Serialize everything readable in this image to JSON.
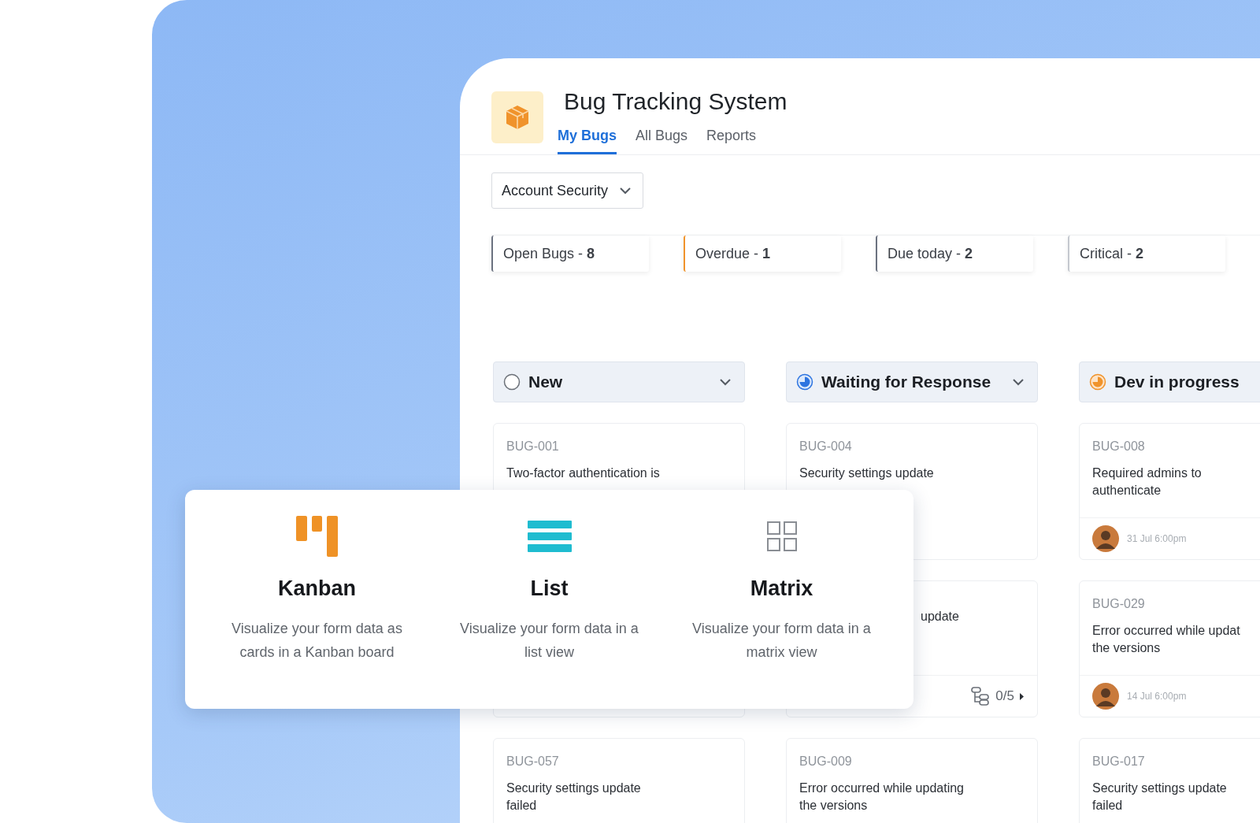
{
  "app": {
    "title": "Bug Tracking System",
    "tabs": [
      {
        "label": "My Bugs",
        "selected": true
      },
      {
        "label": "All Bugs",
        "selected": false
      },
      {
        "label": "Reports",
        "selected": false
      }
    ],
    "filter": {
      "value": "Account Security"
    },
    "stats": [
      {
        "text": "Open Bugs - **8**",
        "color": "#6b7280"
      },
      {
        "text": "Overdue - **1**",
        "color": "#f0932b"
      },
      {
        "text": "Due today - **2**",
        "color": "#6b7280"
      },
      {
        "text": "Critical - **2**",
        "color": "#c4c8cf"
      }
    ],
    "columns": [
      {
        "title": "New",
        "kind": "new",
        "chevron": true,
        "cards": [
          {
            "kind": "card",
            "id": "BUG-001",
            "title": "Two-factor authentication is"
          },
          {
            "kind": "hidden"
          },
          {
            "kind": "card",
            "id": "BUG-057",
            "title": "Security settings update\nfailed"
          }
        ]
      },
      {
        "title": "Waiting for Response",
        "kind": "waiting",
        "chevron": true,
        "cards": [
          {
            "kind": "card",
            "id": "BUG-004",
            "title": "Security settings update"
          },
          {
            "kind": "covered",
            "title": "update",
            "subtasks": "0/5"
          },
          {
            "kind": "card",
            "id": "BUG-009",
            "title": "Error occurred while updating\nthe versions"
          }
        ]
      },
      {
        "title": "Dev in progress",
        "kind": "progress",
        "chevron": false,
        "cards": [
          {
            "kind": "card",
            "id": "BUG-008",
            "title": "Required admins to\nauthenticate",
            "date": "31 Jul 6:00pm"
          },
          {
            "kind": "card",
            "id": "BUG-029",
            "title": "Error occurred while updat\nthe versions",
            "date": "14 Jul 6:00pm"
          },
          {
            "kind": "card",
            "id": "BUG-017",
            "title": "Security settings update\nfailed"
          }
        ]
      }
    ]
  },
  "views": [
    {
      "kind": "kanban",
      "title": "Kanban",
      "text": "Visualize your form data as cards in a Kanban board"
    },
    {
      "kind": "list",
      "title": "List",
      "text": "Visualize your form data in a list view"
    },
    {
      "kind": "matrix",
      "title": "Matrix",
      "text": "Visualize your form data in a matrix view"
    }
  ]
}
